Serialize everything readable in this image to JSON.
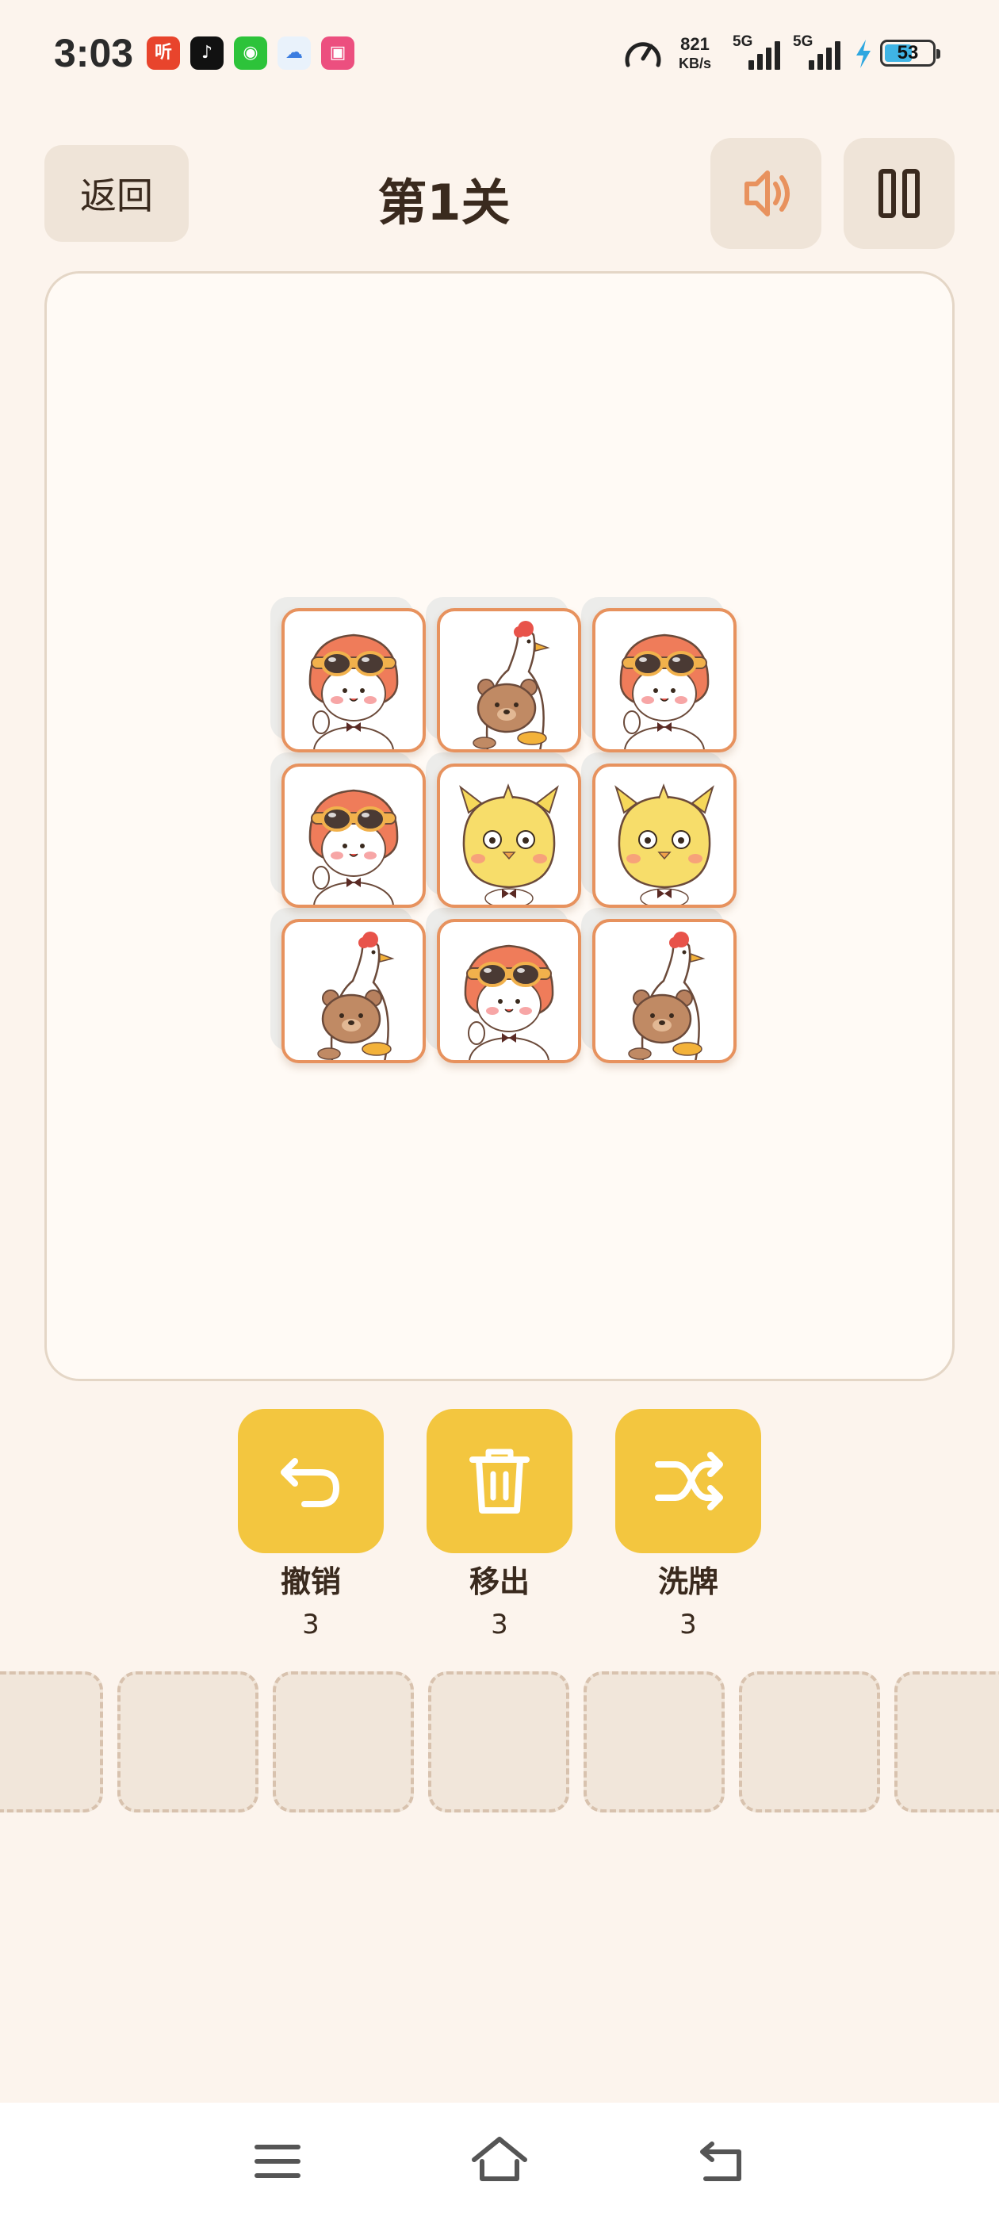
{
  "status_bar": {
    "time": "3:03",
    "apps": [
      {
        "name": "ting-app",
        "glyph": "听",
        "color": "#e8442c"
      },
      {
        "name": "douyin-app",
        "glyph": "♪",
        "color": "#111111"
      },
      {
        "name": "wechat-app",
        "glyph": "◉",
        "color": "#2dc33a"
      },
      {
        "name": "cloud-app",
        "glyph": "☁",
        "color": "#e9f2fb"
      },
      {
        "name": "pink-app",
        "glyph": "▣",
        "color": "#ec4f7f"
      }
    ],
    "net_speed_value": "821",
    "net_speed_unit": "KB/s",
    "sim1_label": "5G",
    "sim2_label": "5G",
    "battery": "53"
  },
  "header": {
    "back_label": "返回",
    "title": "第1关",
    "sound_icon": "speaker-icon",
    "pause_icon": "pause-icon",
    "accent_color": "#e8925e"
  },
  "board": {
    "grid": [
      [
        "pilot-cat",
        "goose-bear",
        "pilot-cat"
      ],
      [
        "pilot-cat",
        "chick-cat",
        "chick-cat"
      ],
      [
        "goose-bear",
        "pilot-cat",
        "goose-bear"
      ]
    ],
    "tile_border_color": "#e7925e"
  },
  "tools": [
    {
      "id": "undo",
      "label": "撤销",
      "count": "3",
      "icon": "undo-icon"
    },
    {
      "id": "remove",
      "label": "移出",
      "count": "3",
      "icon": "trash-icon"
    },
    {
      "id": "shuffle",
      "label": "洗牌",
      "count": "3",
      "icon": "shuffle-icon"
    }
  ],
  "tools_color": "#f3c63f",
  "slots": {
    "visible": 7
  },
  "nav": {
    "menu_icon": "menu-icon",
    "home_icon": "home-icon",
    "back_icon": "back-icon"
  }
}
